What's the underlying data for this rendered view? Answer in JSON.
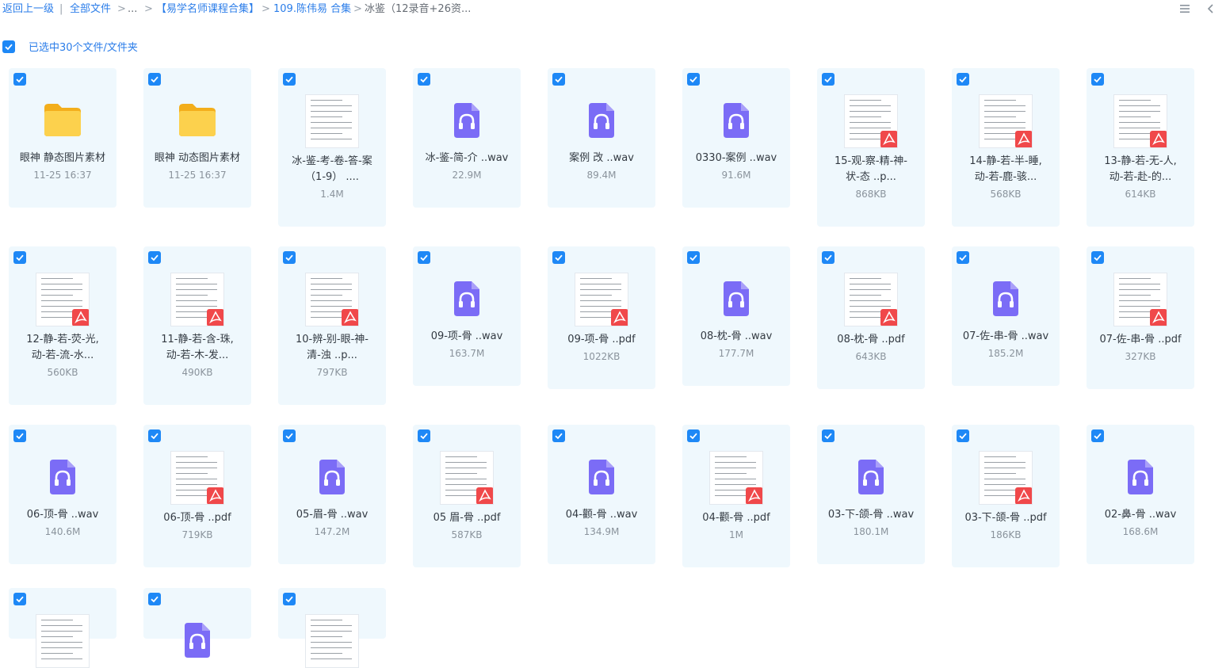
{
  "breadcrumb": {
    "back": "返回上一级",
    "all_files": "全部文件",
    "ellipsis": "...",
    "folder1": "【易学名师课程合集】",
    "folder2": "109.陈伟易 合集",
    "current": "冰鉴（12录音+26资..."
  },
  "toolbar": {
    "list_view_icon": "list-view-icon",
    "back_icon": "chevron-left-icon"
  },
  "selection": {
    "label": "已选中30个文件/文件夹"
  },
  "colors": {
    "accent": "#1e88f6",
    "card_bg": "#eff8fd",
    "audio_icon": "#7b6cf6",
    "pdf_badge": "#f0484a",
    "folder": "#f8c22d"
  },
  "files": [
    {
      "type": "folder",
      "name1": "眼神 静态图片素材",
      "name2": "",
      "meta": "11-25 16:37"
    },
    {
      "type": "folder",
      "name1": "眼神 动态图片素材",
      "name2": "",
      "meta": "11-25 16:37"
    },
    {
      "type": "image",
      "name1": "冰-鉴-考-卷-答-案",
      "name2": "（1-9）  ....",
      "meta": "1.4M"
    },
    {
      "type": "audio",
      "name1": "冰-鉴-简-介 ..wav",
      "name2": "",
      "meta": "22.9M"
    },
    {
      "type": "audio",
      "name1": "案例 改 ..wav",
      "name2": "",
      "meta": "89.4M"
    },
    {
      "type": "audio",
      "name1": "0330-案例 ..wav",
      "name2": "",
      "meta": "91.6M"
    },
    {
      "type": "pdf",
      "name1": "15-观-察-精-神-",
      "name2": "状-态 ..p...",
      "meta": "868KB"
    },
    {
      "type": "pdf",
      "name1": "14-静-若-半-睡,",
      "name2": "动-若-鹿-骇...",
      "meta": "568KB"
    },
    {
      "type": "pdf",
      "name1": "13-静-若-无-人,",
      "name2": "动-若-赴-的...",
      "meta": "614KB"
    },
    {
      "type": "pdf",
      "name1": "12-静-若-荧-光,",
      "name2": "动-若-流-水...",
      "meta": "560KB"
    },
    {
      "type": "pdf",
      "name1": "11-静-若-含-珠,",
      "name2": "动-若-木-发...",
      "meta": "490KB"
    },
    {
      "type": "pdf",
      "name1": "10-辨-别-眼-神-",
      "name2": "清-浊 ..p...",
      "meta": "797KB"
    },
    {
      "type": "audio",
      "name1": "09-项-骨 ..wav",
      "name2": "",
      "meta": "163.7M"
    },
    {
      "type": "pdf",
      "name1": "09-项-骨 ..pdf",
      "name2": "",
      "meta": "1022KB"
    },
    {
      "type": "audio",
      "name1": "08-枕-骨 ..wav",
      "name2": "",
      "meta": "177.7M"
    },
    {
      "type": "pdf",
      "name1": "08-枕-骨 ..pdf",
      "name2": "",
      "meta": "643KB"
    },
    {
      "type": "audio",
      "name1": "07-佐-串-骨 ..wav",
      "name2": "",
      "meta": "185.2M"
    },
    {
      "type": "pdf",
      "name1": "07-佐-串-骨 ..pdf",
      "name2": "",
      "meta": "327KB"
    },
    {
      "type": "audio",
      "name1": "06-顶-骨 ..wav",
      "name2": "",
      "meta": "140.6M"
    },
    {
      "type": "pdf",
      "name1": "06-顶-骨 ..pdf",
      "name2": "",
      "meta": "719KB"
    },
    {
      "type": "audio",
      "name1": "05-眉-骨 ..wav",
      "name2": "",
      "meta": "147.2M"
    },
    {
      "type": "pdf",
      "name1": "05 眉-骨 ..pdf",
      "name2": "",
      "meta": "587KB"
    },
    {
      "type": "audio",
      "name1": "04-颧-骨 ..wav",
      "name2": "",
      "meta": "134.9M"
    },
    {
      "type": "pdf",
      "name1": "04-颧-骨 ..pdf",
      "name2": "",
      "meta": "1M"
    },
    {
      "type": "audio",
      "name1": "03-下-颌-骨 ..wav",
      "name2": "",
      "meta": "180.1M"
    },
    {
      "type": "pdf",
      "name1": "03-下-颌-骨 ..pdf",
      "name2": "",
      "meta": "186KB"
    },
    {
      "type": "audio",
      "name1": "02-鼻-骨 ..wav",
      "name2": "",
      "meta": "168.6M"
    },
    {
      "type": "doc",
      "name1": "",
      "name2": "",
      "meta": ""
    },
    {
      "type": "audio",
      "name1": "",
      "name2": "",
      "meta": ""
    },
    {
      "type": "doc",
      "name1": "",
      "name2": "",
      "meta": ""
    }
  ]
}
